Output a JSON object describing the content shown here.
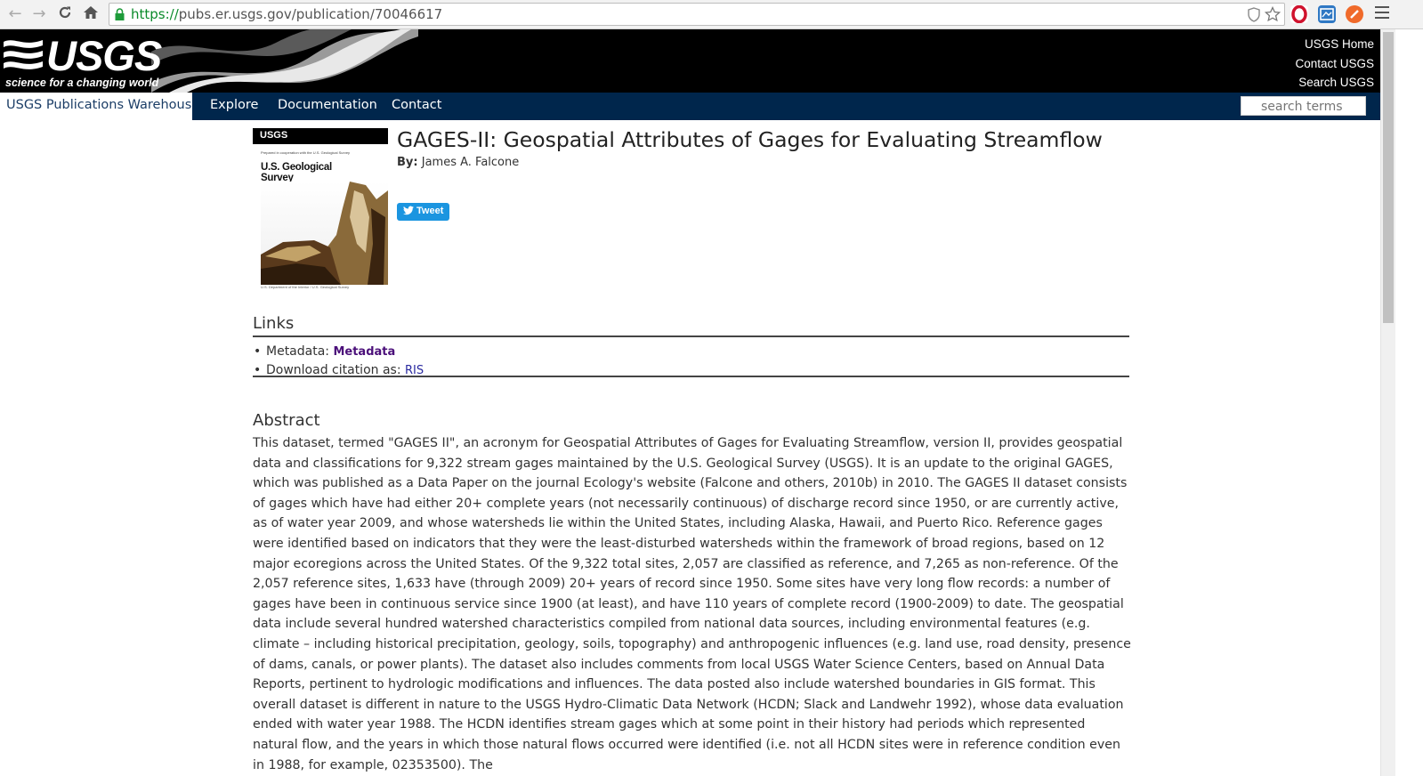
{
  "browser": {
    "url_scheme": "https://",
    "url_rest": "pubs.er.usgs.gov/publication/70046617"
  },
  "header": {
    "logo_text": "USGS",
    "tagline": "science for a changing world",
    "links": [
      "USGS Home",
      "Contact USGS",
      "Search USGS"
    ]
  },
  "nav": {
    "site_label": "USGS Publications Warehouse",
    "items": [
      "Explore",
      "Documentation",
      "Contact"
    ],
    "search_placeholder": "search terms"
  },
  "cover": {
    "band": "USGS",
    "line1": "Prepared in cooperation with the U.S. Geological Survey",
    "title": "U.S. Geological Survey Publication",
    "foot": "U.S. Department of the Interior / U.S. Geological Survey"
  },
  "publication": {
    "title": "GAGES-II: Geospatial Attributes of Gages for Evaluating Streamflow",
    "by_label": "By:",
    "author": "James A. Falcone",
    "tweet_label": "Tweet"
  },
  "links_section": {
    "heading": "Links",
    "metadata_label": "Metadata:",
    "metadata_link": "Metadata",
    "citation_label": "Download citation as:",
    "citation_link": "RIS"
  },
  "abstract": {
    "heading": "Abstract",
    "text": "This dataset, termed \"GAGES II\", an acronym for Geospatial Attributes of Gages for Evaluating Streamflow, version II, provides geospatial data and classifications for 9,322 stream gages maintained by the U.S. Geological Survey (USGS). It is an update to the original GAGES, which was published as a Data Paper on the journal Ecology's website (Falcone and others, 2010b) in 2010. The GAGES II dataset consists of gages which have had either 20+ complete years (not necessarily continuous) of discharge record since 1950, or are currently active, as of water year 2009, and whose watersheds lie within the United States, including Alaska, Hawaii, and Puerto Rico. Reference gages were identified based on indicators that they were the least-disturbed watersheds within the framework of broad regions, based on 12 major ecoregions across the United States. Of the 9,322 total sites, 2,057 are classified as reference, and 7,265 as non-reference. Of the 2,057 reference sites, 1,633 have (through 2009) 20+ years of record since 1950. Some sites have very long flow records: a number of gages have been in continuous service since 1900 (at least), and have 110 years of complete record (1900-2009) to date. The geospatial data include several hundred watershed characteristics compiled from national data sources, including environmental features (e.g. climate – including historical precipitation, geology, soils, topography) and anthropogenic influences (e.g. land use, road density, presence of dams, canals, or power plants). The dataset also includes comments from local USGS Water Science Centers, based on Annual Data Reports, pertinent to hydrologic modifications and influences. The data posted also include watershed boundaries in GIS format. This overall dataset is different in nature to the USGS Hydro-Climatic Data Network (HCDN; Slack and Landwehr 1992), whose data evaluation ended with water year 1988. The HCDN identifies stream gages which at some point in their history had periods which represented natural flow, and the years in which those natural flows occurred were identified (i.e. not all HCDN sites were in reference condition even in 1988, for example, 02353500). The"
  }
}
